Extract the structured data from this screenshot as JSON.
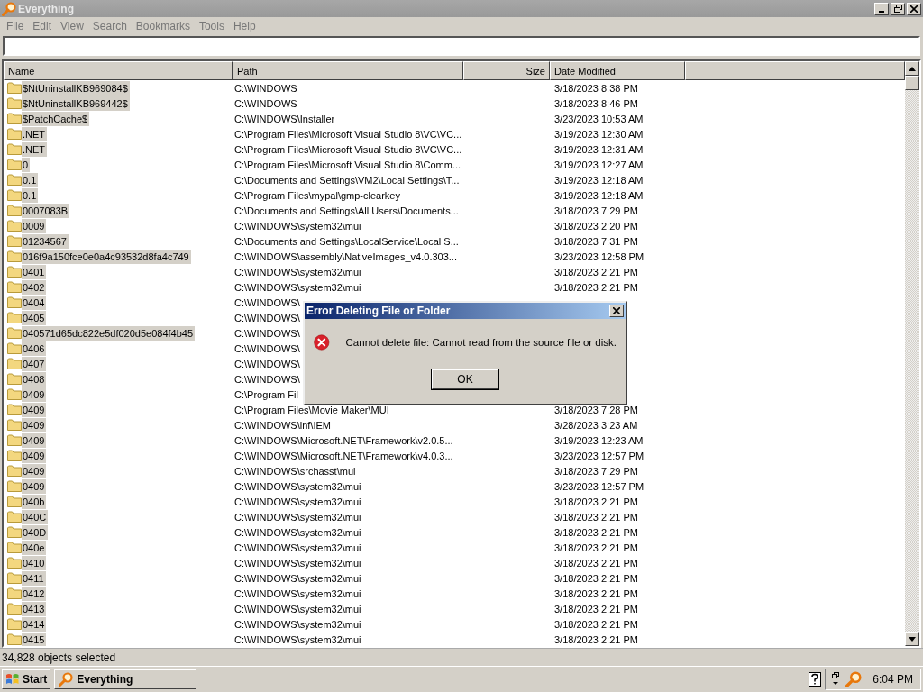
{
  "window": {
    "title": "Everything"
  },
  "menu": [
    "File",
    "Edit",
    "View",
    "Search",
    "Bookmarks",
    "Tools",
    "Help"
  ],
  "table": {
    "columns": [
      "Name",
      "Path",
      "Size",
      "Date Modified"
    ],
    "rows": [
      {
        "name": "$NtUninstallKB969084$",
        "path": "C:\\WINDOWS",
        "date": "3/18/2023 8:38 PM",
        "selected": true
      },
      {
        "name": "$NtUninstallKB969442$",
        "path": "C:\\WINDOWS",
        "date": "3/18/2023 8:46 PM",
        "selected": true
      },
      {
        "name": "$PatchCache$",
        "path": "C:\\WINDOWS\\Installer",
        "date": "3/23/2023 10:53 AM",
        "selected": true
      },
      {
        "name": ".NET",
        "path": "C:\\Program Files\\Microsoft Visual Studio 8\\VC\\VC...",
        "date": "3/19/2023 12:30 AM",
        "selected": true
      },
      {
        "name": ".NET",
        "path": "C:\\Program Files\\Microsoft Visual Studio 8\\VC\\VC...",
        "date": "3/19/2023 12:31 AM",
        "selected": true
      },
      {
        "name": "0",
        "path": "C:\\Program Files\\Microsoft Visual Studio 8\\Comm...",
        "date": "3/19/2023 12:27 AM",
        "selected": true
      },
      {
        "name": "0.1",
        "path": "C:\\Documents and Settings\\VM2\\Local Settings\\T...",
        "date": "3/19/2023 12:18 AM",
        "selected": true
      },
      {
        "name": "0.1",
        "path": "C:\\Program Files\\mypal\\gmp-clearkey",
        "date": "3/19/2023 12:18 AM",
        "selected": true
      },
      {
        "name": "0007083B",
        "path": "C:\\Documents and Settings\\All Users\\Documents...",
        "date": "3/18/2023 7:29 PM",
        "selected": true
      },
      {
        "name": "0009",
        "path": "C:\\WINDOWS\\system32\\mui",
        "date": "3/18/2023 2:20 PM",
        "selected": true
      },
      {
        "name": "01234567",
        "path": "C:\\Documents and Settings\\LocalService\\Local S...",
        "date": "3/18/2023 7:31 PM",
        "selected": true
      },
      {
        "name": "016f9a150fce0e0a4c93532d8fa4c749",
        "path": "C:\\WINDOWS\\assembly\\NativeImages_v4.0.303...",
        "date": "3/23/2023 12:58 PM",
        "selected": true
      },
      {
        "name": "0401",
        "path": "C:\\WINDOWS\\system32\\mui",
        "date": "3/18/2023 2:21 PM",
        "selected": true
      },
      {
        "name": "0402",
        "path": "C:\\WINDOWS\\system32\\mui",
        "date": "3/18/2023 2:21 PM",
        "selected": true
      },
      {
        "name": "0404",
        "path": "C:\\WINDOWS\\",
        "selected": true
      },
      {
        "name": "0405",
        "path": "C:\\WINDOWS\\",
        "selected": true
      },
      {
        "name": "040571d65dc822e5df020d5e084f4b45",
        "path": "C:\\WINDOWS\\",
        "selected": true
      },
      {
        "name": "0406",
        "path": "C:\\WINDOWS\\",
        "selected": true
      },
      {
        "name": "0407",
        "path": "C:\\WINDOWS\\",
        "selected": true
      },
      {
        "name": "0408",
        "path": "C:\\WINDOWS\\",
        "selected": true
      },
      {
        "name": "0409",
        "path": "C:\\Program Fil",
        "selected": true
      },
      {
        "name": "0409",
        "path": "C:\\Program Files\\Movie Maker\\MUI",
        "date": "3/18/2023 7:28 PM",
        "selected": true
      },
      {
        "name": "0409",
        "path": "C:\\WINDOWS\\inf\\IEM",
        "date": "3/28/2023 3:23 AM",
        "selected": true
      },
      {
        "name": "0409",
        "path": "C:\\WINDOWS\\Microsoft.NET\\Framework\\v2.0.5...",
        "date": "3/19/2023 12:23 AM",
        "selected": true
      },
      {
        "name": "0409",
        "path": "C:\\WINDOWS\\Microsoft.NET\\Framework\\v4.0.3...",
        "date": "3/23/2023 12:57 PM",
        "selected": true
      },
      {
        "name": "0409",
        "path": "C:\\WINDOWS\\srchasst\\mui",
        "date": "3/18/2023 7:29 PM",
        "selected": true
      },
      {
        "name": "0409",
        "path": "C:\\WINDOWS\\system32\\mui",
        "date": "3/23/2023 12:57 PM",
        "selected": true
      },
      {
        "name": "040b",
        "path": "C:\\WINDOWS\\system32\\mui",
        "date": "3/18/2023 2:21 PM",
        "selected": true
      },
      {
        "name": "040C",
        "path": "C:\\WINDOWS\\system32\\mui",
        "date": "3/18/2023 2:21 PM",
        "selected": true
      },
      {
        "name": "040D",
        "path": "C:\\WINDOWS\\system32\\mui",
        "date": "3/18/2023 2:21 PM",
        "selected": true
      },
      {
        "name": "040e",
        "path": "C:\\WINDOWS\\system32\\mui",
        "date": "3/18/2023 2:21 PM",
        "selected": true
      },
      {
        "name": "0410",
        "path": "C:\\WINDOWS\\system32\\mui",
        "date": "3/18/2023 2:21 PM",
        "selected": true
      },
      {
        "name": "0411",
        "path": "C:\\WINDOWS\\system32\\mui",
        "date": "3/18/2023 2:21 PM",
        "selected": true
      },
      {
        "name": "0412",
        "path": "C:\\WINDOWS\\system32\\mui",
        "date": "3/18/2023 2:21 PM",
        "selected": true
      },
      {
        "name": "0413",
        "path": "C:\\WINDOWS\\system32\\mui",
        "date": "3/18/2023 2:21 PM",
        "selected": true
      },
      {
        "name": "0414",
        "path": "C:\\WINDOWS\\system32\\mui",
        "date": "3/18/2023 2:21 PM",
        "selected": true
      },
      {
        "name": "0415",
        "path": "C:\\WINDOWS\\system32\\mui",
        "date": "3/18/2023 2:21 PM",
        "selected": true
      }
    ]
  },
  "status_bar": "34,828 objects selected",
  "dialog": {
    "title": "Error Deleting File or Folder",
    "message": "Cannot delete file: Cannot read from the source file or disk.",
    "button": "OK"
  },
  "taskbar": {
    "start": "Start",
    "tasks": [
      {
        "label": "Everything",
        "selected": false
      }
    ],
    "clock": "6:04 PM"
  }
}
